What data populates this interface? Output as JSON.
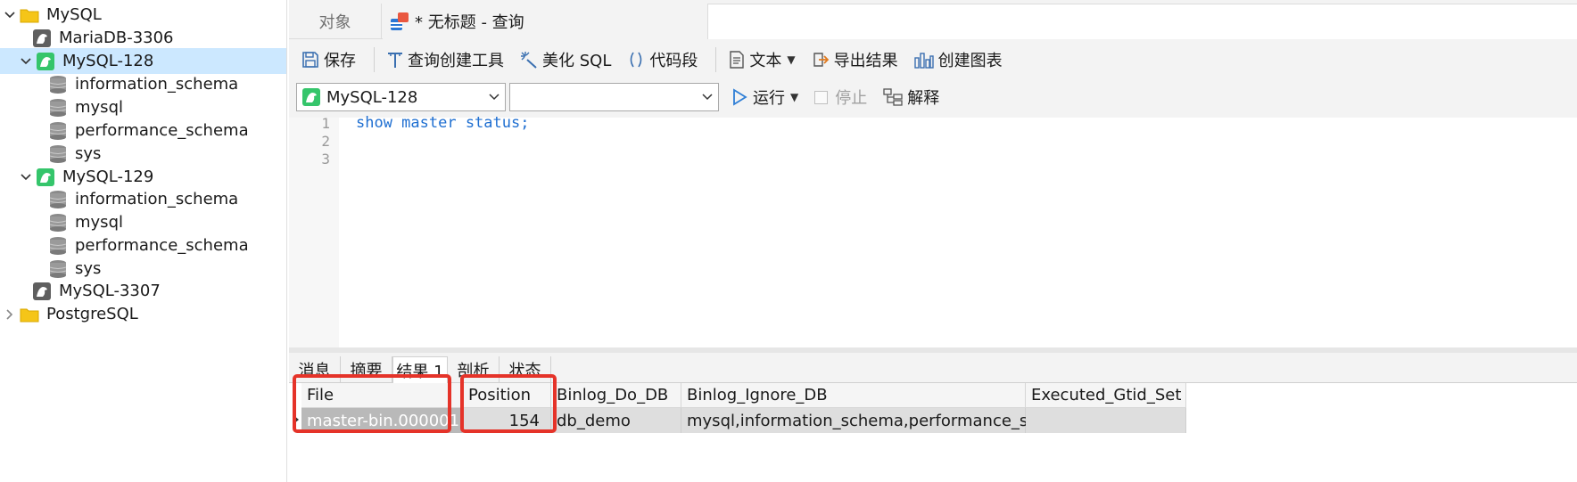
{
  "sidebar": {
    "items": [
      {
        "label": "MySQL",
        "type": "folder",
        "expanded": true
      },
      {
        "label": "MariaDB-3306",
        "type": "conn-gray"
      },
      {
        "label": "MySQL-128",
        "type": "conn-green",
        "expanded": true,
        "selected": true
      },
      {
        "label": "information_schema",
        "type": "db"
      },
      {
        "label": "mysql",
        "type": "db"
      },
      {
        "label": "performance_schema",
        "type": "db"
      },
      {
        "label": "sys",
        "type": "db"
      },
      {
        "label": "MySQL-129",
        "type": "conn-green",
        "expanded": true
      },
      {
        "label": "information_schema",
        "type": "db"
      },
      {
        "label": "mysql",
        "type": "db"
      },
      {
        "label": "performance_schema",
        "type": "db"
      },
      {
        "label": "sys",
        "type": "db"
      },
      {
        "label": "MySQL-3307",
        "type": "conn-gray"
      },
      {
        "label": "PostgreSQL",
        "type": "folder",
        "expanded": false
      }
    ]
  },
  "tabs": {
    "objects": "对象",
    "query": "* 无标题 - 查询"
  },
  "toolbar": {
    "save": "保存",
    "query_builder": "查询创建工具",
    "beautify_sql": "美化 SQL",
    "snippet": "代码段",
    "text": "文本",
    "export_results": "导出结果",
    "create_chart": "创建图表"
  },
  "toolbar2": {
    "connection": "MySQL-128",
    "database": "",
    "run": "运行",
    "stop": "停止",
    "explain": "解释"
  },
  "editor": {
    "line_numbers": [
      "1",
      "2",
      "3"
    ],
    "lines": [
      "show master status;",
      "",
      ""
    ]
  },
  "result_tabs": [
    "消息",
    "摘要",
    "结果 1",
    "剖析",
    "状态"
  ],
  "active_result_tab": "结果 1",
  "results": {
    "columns": [
      "File",
      "Position",
      "Binlog_Do_DB",
      "Binlog_Ignore_DB",
      "Executed_Gtid_Set"
    ],
    "rows": [
      [
        "master-bin.000001",
        "154",
        "db_demo",
        "mysql,information_schema,performance_schema",
        ""
      ]
    ]
  },
  "colors": {
    "selection": "#cce8ff",
    "highlight_box": "#e53329",
    "keyword": "#1f6fd1",
    "mysql_green": "#35c56b"
  }
}
